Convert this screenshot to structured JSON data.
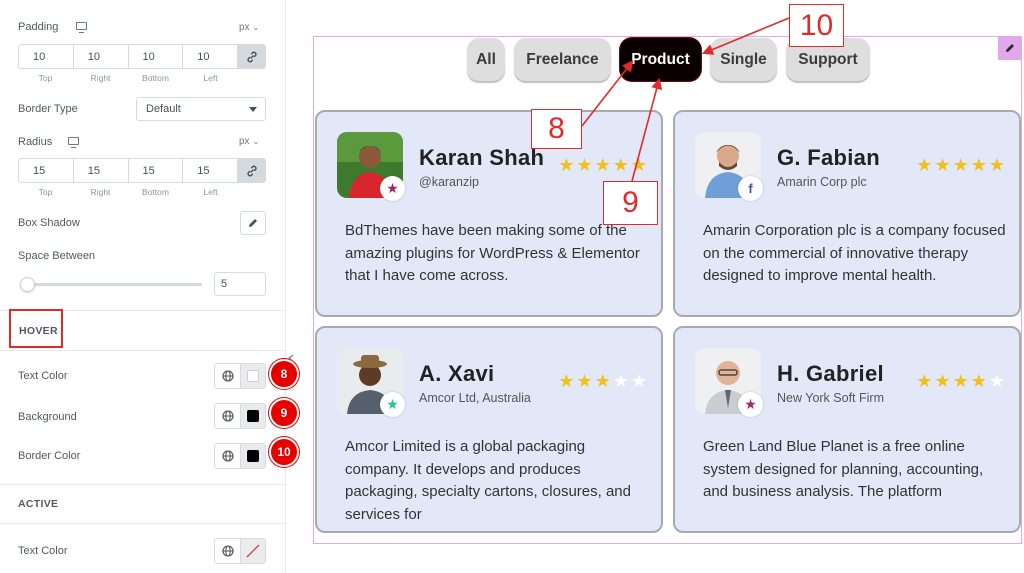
{
  "panel": {
    "padding": {
      "label": "Padding",
      "unit": "px",
      "values": [
        "10",
        "10",
        "10",
        "10"
      ],
      "sides": [
        "Top",
        "Right",
        "Bottom",
        "Left"
      ]
    },
    "border_type": {
      "label": "Border Type",
      "value": "Default"
    },
    "radius": {
      "label": "Radius",
      "unit": "px",
      "values": [
        "15",
        "15",
        "15",
        "15"
      ],
      "sides": [
        "Top",
        "Right",
        "Bottom",
        "Left"
      ]
    },
    "box_shadow": {
      "label": "Box Shadow"
    },
    "space_between": {
      "label": "Space Between",
      "value": "5"
    },
    "hover": {
      "heading": "HOVER",
      "text_color": {
        "label": "Text Color",
        "color": "#ffffff",
        "marker": "8"
      },
      "background": {
        "label": "Background",
        "color": "#000000",
        "marker": "9"
      },
      "border_color": {
        "label": "Border Color",
        "color": "#000000",
        "marker": "10"
      }
    },
    "active": {
      "heading": "ACTIVE",
      "text_color": {
        "label": "Text Color"
      }
    }
  },
  "tabs": [
    {
      "label": "All",
      "active": false
    },
    {
      "label": "Freelance",
      "active": false
    },
    {
      "label": "Product",
      "active": true
    },
    {
      "label": "Single",
      "active": false
    },
    {
      "label": "Support",
      "active": false
    }
  ],
  "cards": [
    {
      "name": "Karan Shah",
      "company": "@karanzip",
      "rating": 5,
      "badge_icon": "star-icon",
      "badge_color": "#a4275d",
      "text": "BdThemes have been making some of the amazing plugins for WordPress & Elementor that I have come across."
    },
    {
      "name": "G. Fabian",
      "company": "Amarin Corp plc",
      "rating": 5,
      "badge_icon": "facebook-icon",
      "badge_color": "#3b5998",
      "text": "Amarin Corporation plc is a company focused on the commercial of innovative therapy designed to improve mental health."
    },
    {
      "name": "A. Xavi",
      "company": "Amcor Ltd, Australia",
      "rating": 3,
      "badge_icon": "star-icon",
      "badge_color": "#1cc88a",
      "text": "Amcor Limited is a global packaging company. It develops and produces packaging, specialty cartons, closures, and services for"
    },
    {
      "name": "H. Gabriel",
      "company": "New York Soft Firm",
      "rating": 4,
      "badge_icon": "star-icon",
      "badge_color": "#a4275d",
      "text": "Green Land Blue Planet is a free online system designed for planning, accounting, and business analysis. The platform"
    }
  ],
  "annotations": {
    "a8": "8",
    "a9": "9",
    "a10": "10"
  },
  "colors": {
    "accent_red": "#e02b2b",
    "active_tab": "#0b0001",
    "card_bg": "#e2e8f8",
    "star": "#f2c01c"
  }
}
